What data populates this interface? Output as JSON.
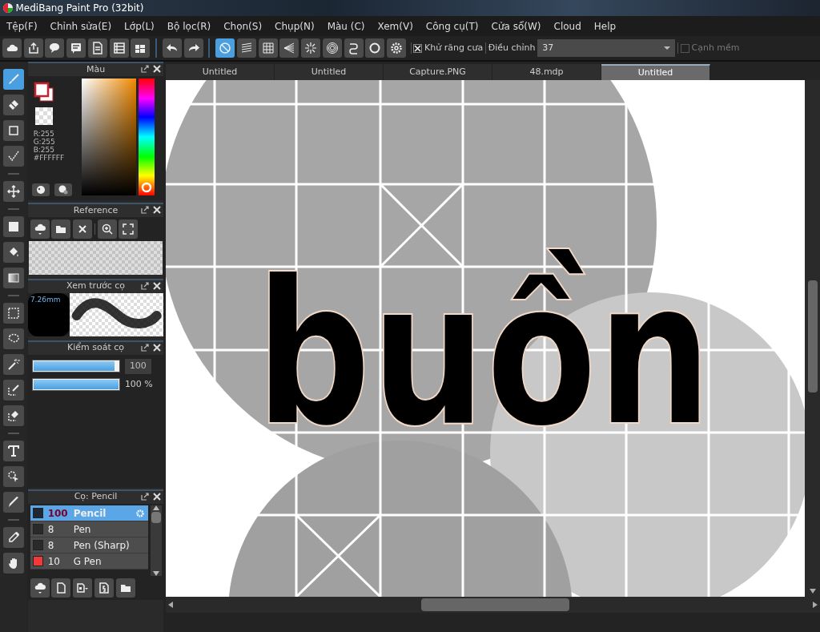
{
  "window": {
    "title": "MediBang Paint Pro (32bit)"
  },
  "menu": [
    "Tệp(F)",
    "Chỉnh sửa(E)",
    "Lớp(L)",
    "Bộ lọc(R)",
    "Chọn(S)",
    "Chụp(N)",
    "Màu (C)",
    "Xem(V)",
    "Công cụ(T)",
    "Cửa sổ(W)",
    "Cloud",
    "Help"
  ],
  "toolbar": {
    "snap_modes": [
      {
        "selected": true
      },
      {
        "selected": false
      },
      {
        "selected": false
      },
      {
        "selected": false
      },
      {
        "selected": false
      },
      {
        "selected": false
      },
      {
        "selected": false
      },
      {
        "selected": false
      }
    ],
    "antialias": {
      "label": "Khử răng cưa",
      "checked": true
    },
    "correction": {
      "label": "Điều chỉnh",
      "value": "37"
    },
    "soft_edge": {
      "label": "Cạnh mềm",
      "checked": false
    }
  },
  "tool_groups": [
    [
      {
        "selected": true
      },
      {
        "selected": false
      },
      {
        "selected": false
      },
      {
        "selected": false
      }
    ],
    [
      {
        "selected": false
      }
    ],
    [
      {
        "selected": false
      },
      {
        "selected": false
      },
      {
        "selected": false
      }
    ],
    [
      {
        "selected": false
      },
      {
        "selected": false
      },
      {
        "selected": false
      },
      {
        "selected": false
      },
      {
        "selected": false
      }
    ],
    [
      {
        "selected": false
      },
      {
        "selected": false
      },
      {
        "selected": false
      }
    ],
    [
      {
        "selected": false
      },
      {
        "selected": false
      }
    ]
  ],
  "color_panel": {
    "title": "Màu",
    "readout": [
      "R:255",
      "G:255",
      "B:255",
      "#FFFFFF"
    ]
  },
  "reference_panel": {
    "title": "Reference"
  },
  "brush_preview_panel": {
    "title": "Xem trước cọ",
    "size": "7.26mm"
  },
  "brush_control_panel": {
    "title": "Kiểm soát cọ",
    "sliders": [
      {
        "level": 0.95,
        "reading": "100"
      },
      {
        "level": 1,
        "reading": "100 %"
      }
    ]
  },
  "brush_panel": {
    "title": "Cọ: Pencil",
    "brushes": [
      {
        "size": "100",
        "name": "Pencil",
        "color": "#1e2832",
        "selected": true
      },
      {
        "size": "8",
        "name": "Pen",
        "color": "#2a2a2a",
        "selected": false
      },
      {
        "size": "8",
        "name": "Pen (Sharp)",
        "color": "#2a2a2a",
        "selected": false
      },
      {
        "size": "10",
        "name": "G Pen",
        "color": "#f03a3a",
        "selected": false
      }
    ]
  },
  "tabs": [
    {
      "label": "Untitled",
      "selected": false
    },
    {
      "label": "Untitled",
      "selected": false
    },
    {
      "label": "Capture.PNG",
      "selected": false
    },
    {
      "label": "48.mdp",
      "selected": false
    },
    {
      "label": "Untitled",
      "selected": true
    }
  ],
  "canvas": {
    "lettering": "buồn"
  }
}
